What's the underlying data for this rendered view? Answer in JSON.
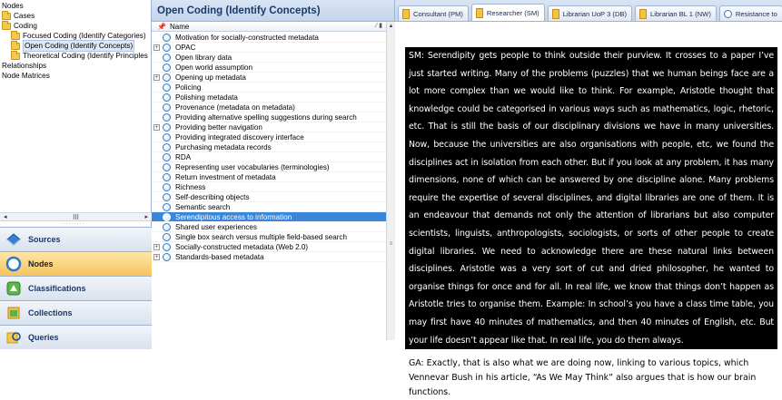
{
  "tree": {
    "items": [
      {
        "label": "Nodes",
        "level": 1,
        "folder": false
      },
      {
        "label": "Cases",
        "level": 1,
        "folder": true
      },
      {
        "label": "Coding",
        "level": 1,
        "folder": true
      },
      {
        "label": "Focused Coding (Identify Categories)",
        "level": 2,
        "folder": true
      },
      {
        "label": "Open Coding (Identify Concepts)",
        "level": 2,
        "folder": true,
        "selected": true
      },
      {
        "label": "Theoretical Coding (Identify Principles",
        "level": 2,
        "folder": true
      },
      {
        "label": "Relationships",
        "level": 1,
        "folder": false
      },
      {
        "label": "Node Matrices",
        "level": 1,
        "folder": false
      }
    ],
    "scroll_thumb": "III"
  },
  "nav": {
    "sources": "Sources",
    "nodes": "Nodes",
    "classifications": "Classifications",
    "collections": "Collections",
    "queries": "Queries"
  },
  "middle": {
    "title": "Open Coding (Identify Concepts)",
    "column_name": "Name",
    "rows": [
      {
        "label": "Motivation for socially-constructed metadata",
        "expander": ""
      },
      {
        "label": "OPAC",
        "expander": "+"
      },
      {
        "label": "Open library data",
        "expander": ""
      },
      {
        "label": "Open world assumption",
        "expander": ""
      },
      {
        "label": "Opening up metadata",
        "expander": "+"
      },
      {
        "label": "Policing",
        "expander": ""
      },
      {
        "label": "Polishing metadata",
        "expander": ""
      },
      {
        "label": "Provenance (metadata on metadata)",
        "expander": ""
      },
      {
        "label": "Providing alternative spelling suggestions during search",
        "expander": ""
      },
      {
        "label": "Providing better navigation",
        "expander": "+"
      },
      {
        "label": "Providing integrated discovery interface",
        "expander": ""
      },
      {
        "label": "Purchasing metadata records",
        "expander": ""
      },
      {
        "label": "RDA",
        "expander": ""
      },
      {
        "label": "Representing user vocabularies (terminologies)",
        "expander": ""
      },
      {
        "label": "Return investment of metadata",
        "expander": ""
      },
      {
        "label": "Richness",
        "expander": ""
      },
      {
        "label": "Self-describing objects",
        "expander": ""
      },
      {
        "label": "Semantic search",
        "expander": ""
      },
      {
        "label": "Serendipitous access to information",
        "expander": "",
        "selected": true
      },
      {
        "label": "Shared user experiences",
        "expander": ""
      },
      {
        "label": "Single box search versus multiple field-based search",
        "expander": ""
      },
      {
        "label": "Socially-constructed metadata (Web 2.0)",
        "expander": "+"
      },
      {
        "label": "Standards-based metadata",
        "expander": "+"
      }
    ]
  },
  "tabs": [
    {
      "label": "Consultant (PM)",
      "kind": "doc"
    },
    {
      "label": "Researcher (SM)",
      "kind": "doc",
      "active": true
    },
    {
      "label": "Librarian UoP 3 (DB)",
      "kind": "doc"
    },
    {
      "label": "Librarian BL 1 (NW)",
      "kind": "doc"
    },
    {
      "label": "Resistance to",
      "kind": "node"
    }
  ],
  "document": {
    "highlighted": "SM: Serendipity gets people to think outside their purview. It crosses to a paper I’ve just started writing. Many of the problems (puzzles) that we human beings face are a lot more complex than we would like to think. For example, Aristotle thought that knowledge could be categorised in various ways such as mathematics, logic, rhetoric, etc. That is still the basis of our disciplinary divisions we have in many universities. Now, because the universities are also organisations with people, etc, we found the disciplines act in isolation from each other. But if you look at any problem, it has many dimensions, none of which can be answered by one discipline alone. Many problems require the expertise of several disciplines, and digital libraries are one of them.  It is an endeavour that demands not only the attention of librarians but also computer scientists, linguists, anthropologists, sociologists, or sorts of other people to create digital libraries. We need to acknowledge there are these natural links between disciplines.  Aristotle was a very sort of cut and dried philosopher, he wanted to organise things for once and for all. In real life, we know that things don’t happen as Aristotle tries to organise them. Example: In school’s you have a class time table, you may first have 40 minutes of mathematics, and then 40 minutes of English, etc. But your life doesn’t appear like that. In real life, you do them always.",
    "following": "GA: Exactly, that is also what we are doing now, linking to various topics, which Vennevar Bush in his article, “As We May Think” also argues that is how our brain functions."
  }
}
